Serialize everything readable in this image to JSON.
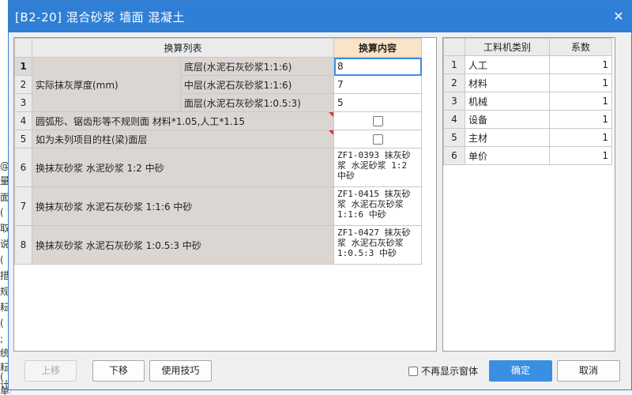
{
  "background": {
    "left_chars": [
      "@",
      "量",
      "面",
      "(",
      "取",
      "说",
      "(",
      "措",
      "规",
      "耘",
      "(",
      ";",
      "统",
      "耘",
      "(",
      "计",
      "单"
    ]
  },
  "dialog": {
    "title": "[B2-20] 混合砂浆 墙面 混凝土",
    "close_glyph": "✕"
  },
  "conversion_table": {
    "header_list": "换算列表",
    "header_content": "换算内容",
    "thickness_label": "实际抹灰厚度(mm)",
    "rows": [
      {
        "no": "1",
        "sub_label": "底层(水泥石灰砂浆1:1:6)",
        "value": "8"
      },
      {
        "no": "2",
        "sub_label": "中层(水泥石灰砂浆1:1:6)",
        "value": "7"
      },
      {
        "no": "3",
        "sub_label": "面层(水泥石灰砂浆1:0.5:3)",
        "value": "5"
      },
      {
        "no": "4",
        "label": "圆弧形、锯齿形等不规则面 材料*1.05,人工*1.15",
        "checked": false
      },
      {
        "no": "5",
        "label": "如为未列项目的柱(梁)面层",
        "checked": false
      },
      {
        "no": "6",
        "label": "换抹灰砂浆 水泥砂浆 1:2 中砂",
        "content": "ZF1-0393 抹灰砂浆 水泥砂浆 1:2 中砂"
      },
      {
        "no": "7",
        "label": "换抹灰砂浆 水泥石灰砂浆 1:1:6 中砂",
        "content": "ZF1-0415 抹灰砂浆 水泥石灰砂浆 1:1:6 中砂"
      },
      {
        "no": "8",
        "label": "换抹灰砂浆 水泥石灰砂浆 1:0.5:3 中砂",
        "content": "ZF1-0427 抹灰砂浆 水泥石灰砂浆 1:0.5:3 中砂"
      }
    ]
  },
  "category_table": {
    "header_category": "工料机类别",
    "header_coef": "系数",
    "rows": [
      {
        "no": "1",
        "category": "人工",
        "coef": "1"
      },
      {
        "no": "2",
        "category": "材料",
        "coef": "1"
      },
      {
        "no": "3",
        "category": "机械",
        "coef": "1"
      },
      {
        "no": "4",
        "category": "设备",
        "coef": "1"
      },
      {
        "no": "5",
        "category": "主材",
        "coef": "1"
      },
      {
        "no": "6",
        "category": "单价",
        "coef": "1"
      }
    ]
  },
  "footer": {
    "move_up": "上移",
    "move_down": "下移",
    "tips": "使用技巧",
    "no_show_label": "不再显示窗体",
    "no_show_checked": false,
    "ok": "确定",
    "cancel": "取消"
  },
  "colors": {
    "titlebar": "#2f7fd7",
    "primary_button": "#3b8fe3",
    "header_orange": "#fbe3c5",
    "gray_cell": "#dcd6d3",
    "selection_border": "#3e8de0",
    "corner_mark": "#e03030"
  }
}
